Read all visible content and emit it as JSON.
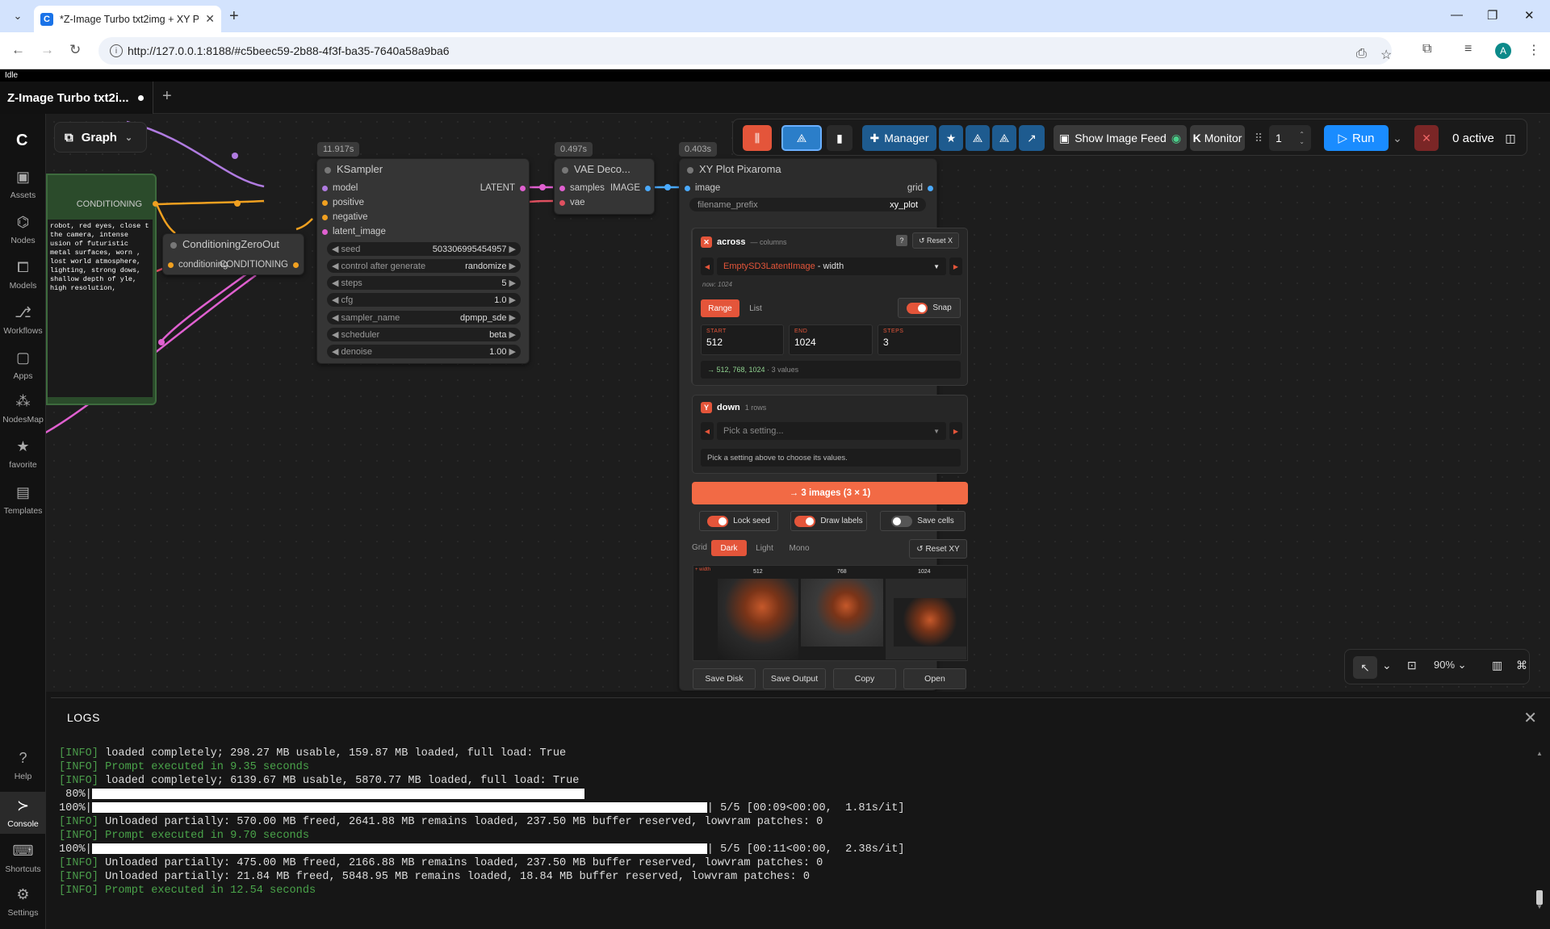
{
  "browser": {
    "tab_title": "*Z-Image Turbo txt2img + XY P",
    "url": "http://127.0.0.1:8188/#c5beec59-2b88-4f3f-ba35-7640a58a9ba6",
    "profile_initial": "A"
  },
  "app": {
    "status": "Idle",
    "workflow_tab": "Z-Image Turbo txt2i...",
    "graph_label": "Graph"
  },
  "sidebar": {
    "items": [
      {
        "label": "Assets",
        "icon": "assets-icon"
      },
      {
        "label": "Nodes",
        "icon": "nodes-icon"
      },
      {
        "label": "Models",
        "icon": "models-icon"
      },
      {
        "label": "Workflows",
        "icon": "workflows-icon"
      },
      {
        "label": "Apps",
        "icon": "apps-icon"
      },
      {
        "label": "NodesMap",
        "icon": "nodesmap-icon"
      },
      {
        "label": "favorite",
        "icon": "star-icon"
      },
      {
        "label": "Templates",
        "icon": "templates-icon"
      }
    ],
    "bottom": [
      {
        "label": "Help",
        "icon": "help-icon"
      },
      {
        "label": "Console",
        "icon": "console-icon"
      },
      {
        "label": "Shortcuts",
        "icon": "keyboard-icon"
      },
      {
        "label": "Settings",
        "icon": "gear-icon"
      }
    ]
  },
  "toolbar": {
    "manager": "Manager",
    "show_image_feed": "Show Image Feed",
    "monitor": "Monitor",
    "queue_count": "1",
    "run": "Run",
    "active": "0 active"
  },
  "nodes": {
    "conditioning_label": "CONDITIONING",
    "prompt_text": "robot, red eyes, close\nt the camera, intense\nusion of futuristic\nmetal surfaces, worn\n, lost world atmosphere,\n lighting, strong\ndows, shallow depth of\nyle, high resolution,",
    "cond_zero": {
      "title": "ConditioningZeroOut",
      "input": "conditioning",
      "output": "CONDITIONING"
    },
    "ksampler": {
      "time": "11.917s",
      "title": "KSampler",
      "inputs": [
        "model",
        "positive",
        "negative",
        "latent_image"
      ],
      "output": "LATENT",
      "widgets": [
        {
          "name": "seed",
          "value": "503306995454957"
        },
        {
          "name": "control after generate",
          "value": "randomize"
        },
        {
          "name": "steps",
          "value": "5"
        },
        {
          "name": "cfg",
          "value": "1.0"
        },
        {
          "name": "sampler_name",
          "value": "dpmpp_sde"
        },
        {
          "name": "scheduler",
          "value": "beta"
        },
        {
          "name": "denoise",
          "value": "1.00"
        }
      ]
    },
    "vae": {
      "time": "0.497s",
      "title": "VAE Deco...",
      "inputs": [
        "samples",
        "vae"
      ],
      "output": "IMAGE"
    },
    "xy": {
      "time": "0.403s",
      "title": "XY Plot Pixaroma",
      "input": "image",
      "output": "grid",
      "filename_prefix_label": "filename_prefix",
      "filename_prefix_value": "xy_plot"
    }
  },
  "xy_panel": {
    "across": {
      "label": "across",
      "sub": "— columns",
      "help": "?",
      "reset": "↺ Reset X",
      "setting_node": "EmptySD3LatentImage",
      "setting_param": "- width",
      "now": "now: 1024",
      "mode_range": "Range",
      "mode_list": "List",
      "snap": "Snap",
      "start_label": "START",
      "start": "512",
      "end_label": "END",
      "end": "1024",
      "steps_label": "STEPS",
      "steps": "3",
      "summary_values": "→ 512, 768, 1024",
      "summary_count": "· 3 values"
    },
    "down": {
      "label": "down",
      "sub": "1 rows",
      "placeholder": "Pick a setting...",
      "hint": "Pick a setting above to choose its values."
    },
    "run_button": "→ 3 images (3 × 1)",
    "lock_seed": "Lock seed",
    "draw_labels": "Draw labels",
    "save_cells": "Save cells",
    "grid_label": "Grid",
    "grid_modes": [
      "Dark",
      "Light",
      "Mono"
    ],
    "reset_xy": "↺ Reset XY",
    "preview_cols": [
      "512",
      "768",
      "1024"
    ],
    "preview_corner": "+ width",
    "actions": [
      "Save Disk",
      "Save Output",
      "Copy",
      "Open"
    ]
  },
  "canvas_controls": {
    "zoom": "90%"
  },
  "logs": {
    "title": "LOGS",
    "lines": [
      {
        "type": "info",
        "tag": "[INFO]",
        "text": " loaded completely; 298.27 MB usable, 159.87 MB loaded, full load: True"
      },
      {
        "type": "ok",
        "tag": "[INFO]",
        "text": " Prompt executed in 9.35 seconds"
      },
      {
        "type": "info",
        "tag": "[INFO]",
        "text": " loaded completely; 6139.67 MB usable, 5870.77 MB loaded, full load: True"
      },
      {
        "type": "bar",
        "pct": " 80%|",
        "fill": 0.8,
        "tail": ""
      },
      {
        "type": "bar",
        "pct": "100%|",
        "fill": 1.0,
        "tail": "| 5/5 [00:09<00:00,  1.81s/it]"
      },
      {
        "type": "info",
        "tag": "[INFO]",
        "text": " Unloaded partially: 570.00 MB freed, 2641.88 MB remains loaded, 237.50 MB buffer reserved, lowvram patches: 0"
      },
      {
        "type": "ok",
        "tag": "[INFO]",
        "text": " Prompt executed in 9.70 seconds"
      },
      {
        "type": "bar",
        "pct": "100%|",
        "fill": 1.0,
        "tail": "| 5/5 [00:11<00:00,  2.38s/it]"
      },
      {
        "type": "info",
        "tag": "[INFO]",
        "text": " Unloaded partially: 475.00 MB freed, 2166.88 MB remains loaded, 237.50 MB buffer reserved, lowvram patches: 0"
      },
      {
        "type": "info",
        "tag": "[INFO]",
        "text": " Unloaded partially: 21.84 MB freed, 5848.95 MB remains loaded, 18.84 MB buffer reserved, lowvram patches: 0"
      },
      {
        "type": "ok",
        "tag": "[INFO]",
        "text": " Prompt executed in 12.54 seconds"
      }
    ]
  },
  "colors": {
    "accent": "#e4553a",
    "run": "#1a8cff",
    "manager": "#1e5b8f"
  }
}
